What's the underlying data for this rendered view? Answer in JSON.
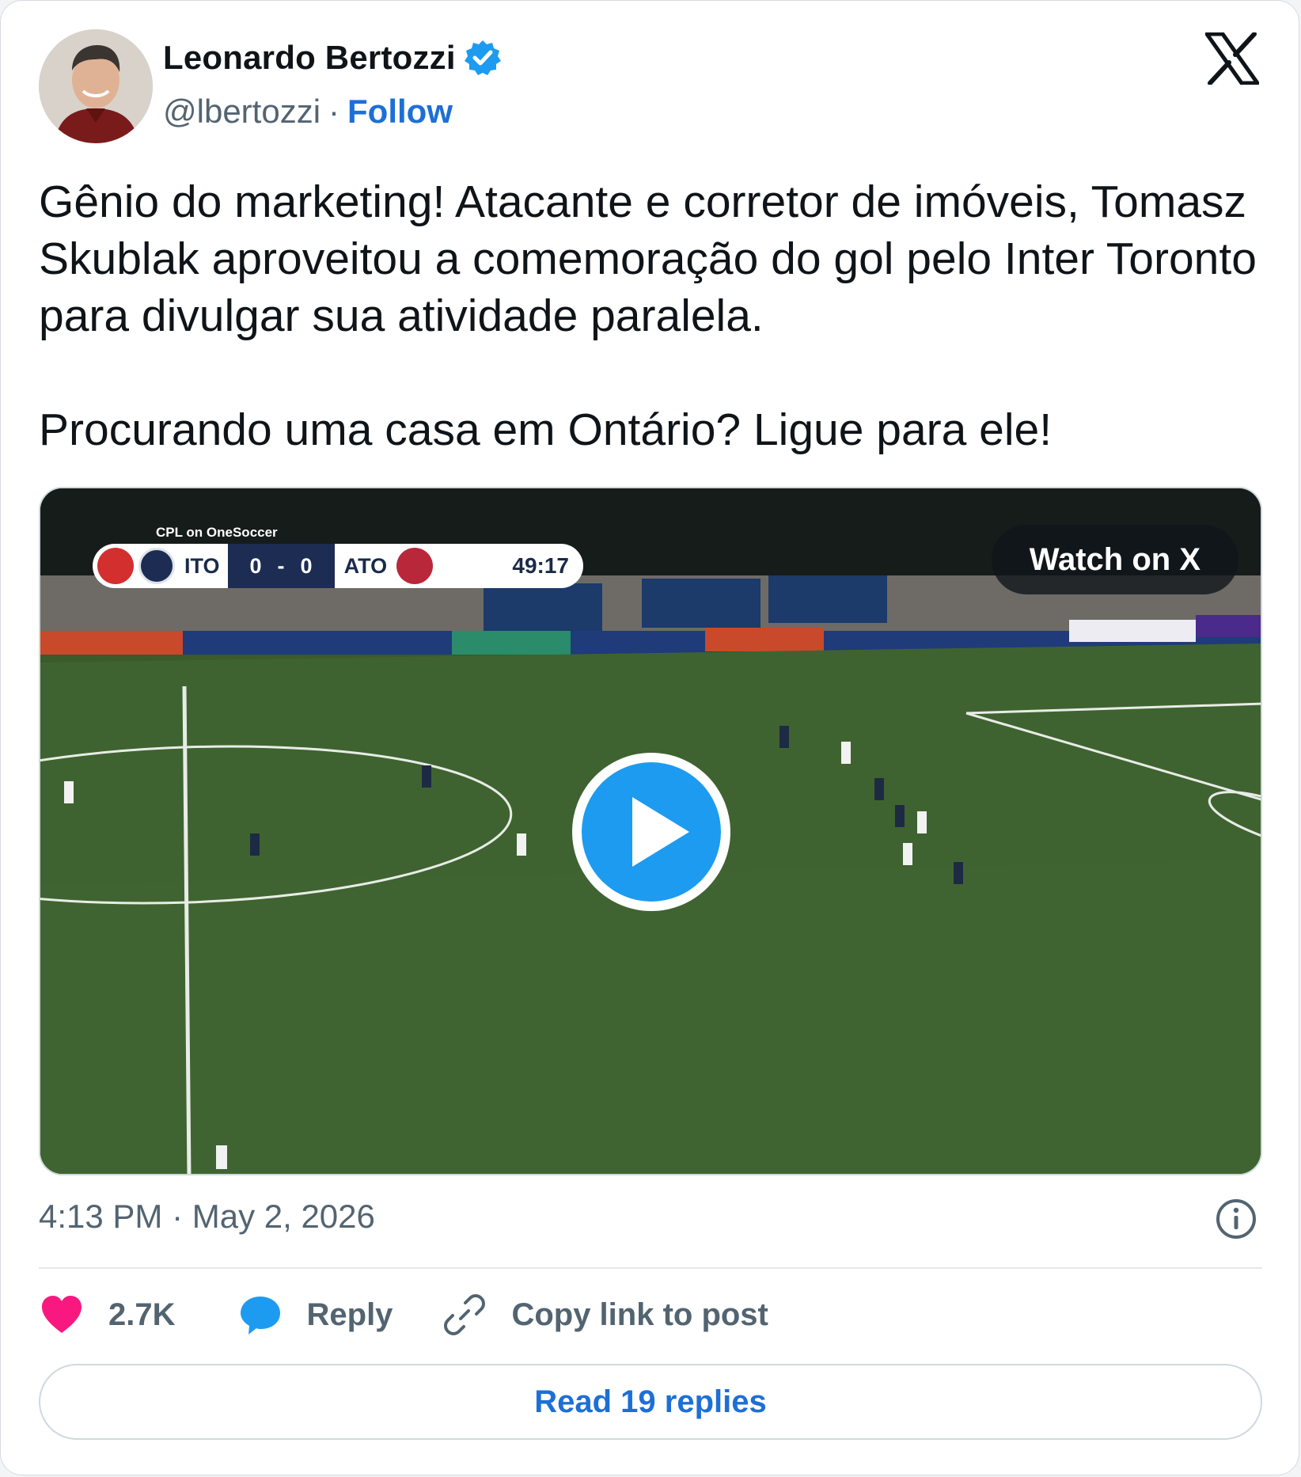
{
  "author": {
    "name": "Leonardo Bertozzi",
    "handle": "@lbertozzi",
    "separator": "·",
    "follow_label": "Follow",
    "verified": true
  },
  "tweet": {
    "text": "Gênio do marketing! Atacante e corretor de imóveis, Tomasz Skublak aproveitou a comemoração do gol pelo Inter Toronto para divulgar sua atividade paralela.\n\nProcurando uma casa em Ontário? Ligue para ele!"
  },
  "media": {
    "watch_label": "Watch on X",
    "scoreboard": {
      "caption": "CPL on OneSoccer",
      "home_team": "ITO",
      "home_score": "0",
      "score_sep": "-",
      "away_score": "0",
      "away_team": "ATO",
      "clock": "49:17"
    }
  },
  "meta": {
    "timestamp": "4:13 PM · May 2, 2026"
  },
  "actions": {
    "likes": "2.7K",
    "reply_label": "Reply",
    "copy_label": "Copy link to post"
  },
  "read_replies_label": "Read 19 replies",
  "colors": {
    "accent": "#1d9bf0",
    "link": "#1d6fd6",
    "like": "#f91880",
    "secondary_text": "#536471"
  }
}
